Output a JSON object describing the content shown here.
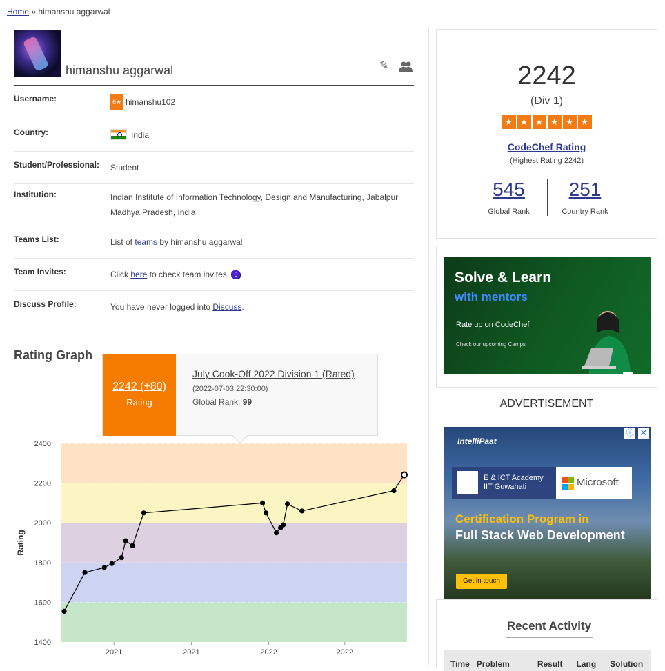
{
  "breadcrumb": {
    "home": "Home",
    "separator": "»",
    "current": "himanshu aggarwal"
  },
  "profile": {
    "name": "himanshu aggarwal"
  },
  "info": {
    "username_label": "Username:",
    "stars_badge": "6★",
    "username": "himanshu102",
    "country_label": "Country:",
    "country": "India",
    "student_label": "Student/Professional:",
    "student": "Student",
    "institution_label": "Institution:",
    "institution_line1": "Indian Institute of Information Technology, Design and Manufacturing, Jabalpur",
    "institution_line2": "Madhya Pradesh, India",
    "teams_label": "Teams List:",
    "teams_prefix": "List of",
    "teams_link": "teams",
    "teams_suffix": "by himanshu aggarwal",
    "invites_label": "Team Invites:",
    "invites_prefix": "Click",
    "invites_link": "here",
    "invites_suffix": "to check team invites.",
    "invites_count": "0",
    "discuss_label": "Discuss Profile:",
    "discuss_prefix": "You have never logged into",
    "discuss_link": "Discuss",
    "discuss_suffix": "."
  },
  "rating_graph": {
    "title": "Rating Graph",
    "tooltip": {
      "rating": "2242 (+80)",
      "rating_label": "Rating",
      "contest": "July Cook-Off 2022 Division 1 (Rated)",
      "date": "(2022-07-03 22:30:00)",
      "rank_label": "Global Rank:",
      "rank": "99"
    }
  },
  "chart_data": {
    "type": "line",
    "ylabel": "Rating",
    "ylim": [
      1400,
      2400
    ],
    "yticks": [
      "2400",
      "2200",
      "2000",
      "1800",
      "1600",
      "1400"
    ],
    "xticks": [
      "2021",
      "2021",
      "2022",
      "2022"
    ],
    "xtick_positions": [
      0.152,
      0.376,
      0.6,
      0.82
    ],
    "bands": [
      {
        "from": 1400,
        "to": 1600,
        "color": "#c5e6c8"
      },
      {
        "from": 1600,
        "to": 1800,
        "color": "#cdd4f2"
      },
      {
        "from": 1800,
        "to": 2000,
        "color": "#ddd0e0"
      },
      {
        "from": 2000,
        "to": 2200,
        "color": "#fbf5c4"
      },
      {
        "from": 2200,
        "to": 2400,
        "color": "#fde2c6"
      }
    ],
    "series": [
      {
        "x": [
          0.008,
          0.068,
          0.124,
          0.146,
          0.174,
          0.186,
          0.206,
          0.238,
          0.582,
          0.592,
          0.622,
          0.634,
          0.642,
          0.654,
          0.696,
          0.962,
          0.992
        ],
        "values": [
          1555,
          1750,
          1775,
          1795,
          1825,
          1910,
          1885,
          2050,
          2100,
          2050,
          1950,
          1975,
          1990,
          2095,
          2060,
          2162,
          2242
        ]
      }
    ],
    "line_color": "#000000",
    "grid": false
  },
  "rating_card": {
    "rating": "2242",
    "division": "(Div 1)",
    "stars": [
      "★",
      "★",
      "★",
      "★",
      "★",
      "★"
    ],
    "link": "CodeChef Rating",
    "highest": "(Highest Rating 2242)",
    "global_rank": "545",
    "global_rank_label": "Global Rank",
    "country_rank": "251",
    "country_rank_label": "Country Rank",
    "star_color": "#f47b14"
  },
  "ad1": {
    "title": "Solve & Learn",
    "subtitle": "with mentors",
    "line": "Rate up on CodeChef",
    "small": "Check our upcoming Camps"
  },
  "advertisement_label": "ADVERTISEMENT",
  "ad2": {
    "brand": "IntelliPaat",
    "academy_line1": "E & ICT Academy",
    "academy_line2": "IIT Guwahati",
    "partner": "Microsoft",
    "headline": "Certification Program in",
    "course": "Full Stack Web Development",
    "cta": "Get in touch",
    "info_icon": "ⓘ",
    "close_icon": "✕"
  },
  "recent_activity": {
    "title": "Recent Activity",
    "columns": [
      "Time",
      "Problem",
      "Result",
      "Lang",
      "Solution"
    ]
  }
}
